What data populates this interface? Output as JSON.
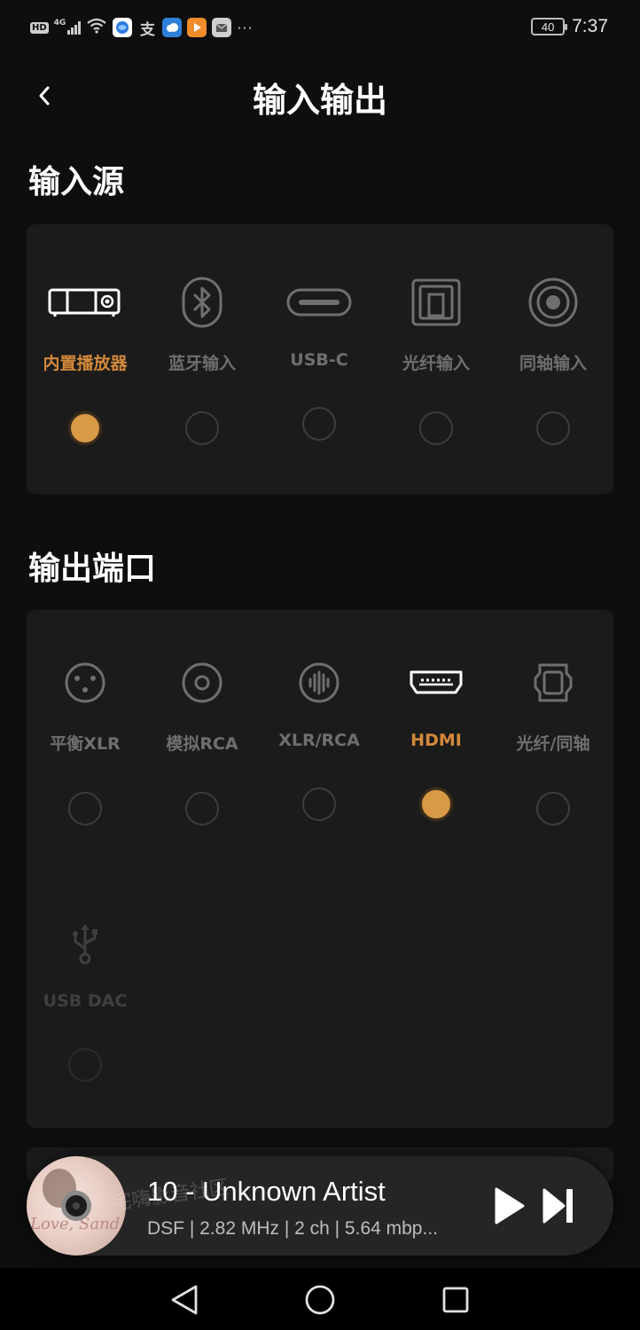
{
  "status_bar": {
    "hd": "HD",
    "network": "4G",
    "battery": "40",
    "time": "7:37",
    "more": "···",
    "app_icons": [
      "browser-icon",
      "alipay-icon",
      "weather-icon",
      "video-icon",
      "huawei-mail-icon"
    ]
  },
  "header": {
    "title": "输入输出"
  },
  "input_section": {
    "title": "输入源",
    "options": [
      {
        "label": "内置播放器",
        "icon": "built-in-player-icon",
        "selected": true
      },
      {
        "label": "蓝牙输入",
        "icon": "bluetooth-icon",
        "selected": false
      },
      {
        "label": "USB-C",
        "icon": "usb-c-icon",
        "selected": false
      },
      {
        "label": "光纤输入",
        "icon": "optical-icon",
        "selected": false
      },
      {
        "label": "同轴输入",
        "icon": "coaxial-icon",
        "selected": false
      }
    ]
  },
  "output_section": {
    "title": "输出端口",
    "options": [
      {
        "label": "平衡XLR",
        "icon": "xlr-icon",
        "selected": false
      },
      {
        "label": "模拟RCA",
        "icon": "rca-icon",
        "selected": false
      },
      {
        "label": "XLR/RCA",
        "icon": "xlr-rca-icon",
        "selected": false
      },
      {
        "label": "HDMI",
        "icon": "hdmi-icon",
        "selected": true
      },
      {
        "label": "光纤/同轴",
        "icon": "optical-coaxial-icon",
        "selected": false
      },
      {
        "label": "USB DAC",
        "icon": "usb-icon",
        "selected": false,
        "disabled": true
      }
    ]
  },
  "player": {
    "title": "10 - Unknown Artist",
    "meta": "DSF | 2.82 MHz | 2 ch | 5.64 mbp...",
    "album_text": "Love, Sand",
    "watermark": "宅嗨影音社区"
  },
  "colors": {
    "accent": "#d99a45",
    "accent_label": "#d4883a",
    "card": "#1b1b1b",
    "background": "#0e0e0e"
  }
}
